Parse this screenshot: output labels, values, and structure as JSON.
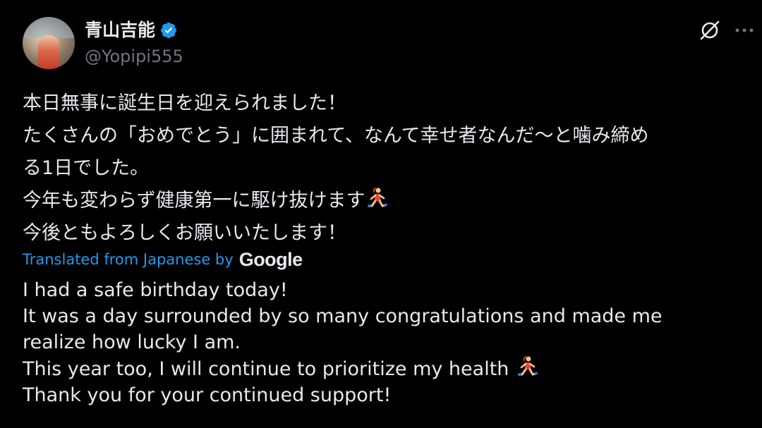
{
  "author": {
    "display_name": "青山吉能",
    "handle": "@Yopipi555",
    "verified_icon": "verified-badge-icon"
  },
  "actions": {
    "grok_icon": "grok-icon",
    "more_icon": "more-options-icon"
  },
  "post": {
    "original_lines": [
      "本日無事に誕生日を迎えられました！",
      "たくさんの「おめでとう」に囲まれて、なんて幸せ者なんだ〜と噛み締め",
      "る1日でした。",
      "今年も変わらず健康第一に駆け抜けます",
      "今後ともよろしくお願いいたします！"
    ],
    "emoji": "woman-running-icon"
  },
  "translation": {
    "label": "Translated from Japanese by",
    "provider": "Google",
    "lines": [
      "I had a safe birthday today!",
      "It was a day surrounded by so many congratulations and made me",
      "realize how lucky I am.",
      "This year too, I will continue to prioritize my health",
      "Thank you for your continued support!"
    ]
  },
  "colors": {
    "background": "#000000",
    "text": "#e7e9ea",
    "secondary": "#71767b",
    "accent": "#1d9bf0"
  }
}
